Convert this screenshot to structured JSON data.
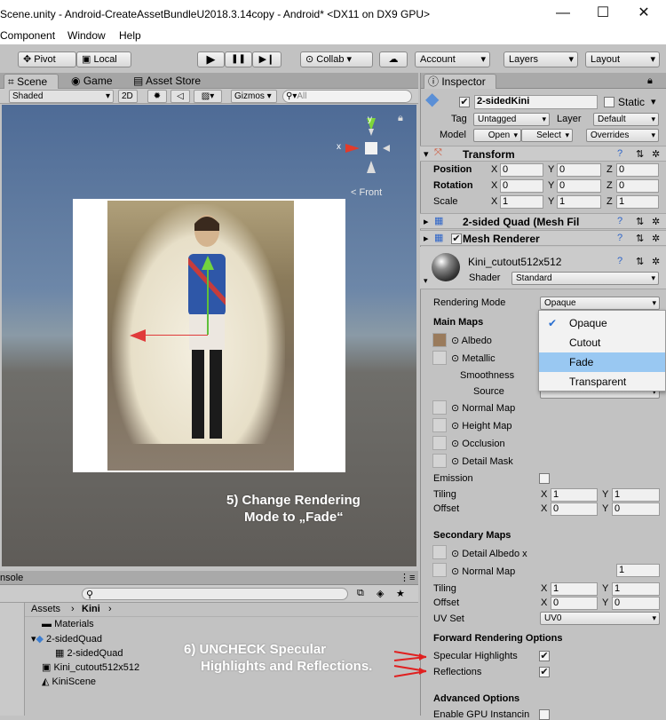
{
  "titlebar": {
    "title": "Scene.unity - Android-CreateAssetBundleU2018.3.14copy - Android* <DX11 on DX9 GPU>",
    "minimize": "—",
    "maximize": "☐",
    "close": "✕"
  },
  "menu": {
    "items": [
      "Component",
      "Window",
      "Help"
    ]
  },
  "toolbar": {
    "pivot": "Pivot",
    "local": "Local",
    "play": "▶",
    "pause": "❚❚",
    "step": "▶❙",
    "collab": "Collab",
    "account": "Account",
    "layers": "Layers",
    "layout": "Layout"
  },
  "scene_tabs": {
    "scene": "Scene",
    "game": "Game",
    "asset_store": "Asset Store"
  },
  "scene_bar": {
    "shading": "Shaded",
    "mode_2d": "2D",
    "gizmos": "Gizmos",
    "search_placeholder": "All"
  },
  "gizmo": {
    "y": "y",
    "x": "x",
    "front": "Front"
  },
  "captions": {
    "step5_line1": "5) Change Rendering",
    "step5_line2": "Mode to „Fade“",
    "step6_line1": "6) UNCHECK Specular",
    "step6_line2": "Highlights and Reflections."
  },
  "console": {
    "tab": "nsole",
    "breadcrumb_root": "Assets",
    "breadcrumb_child": "Kini",
    "assets": [
      "Materials",
      "2-sidedQuad",
      "2-sidedQuad",
      "Kini_cutout512x512",
      "KiniScene"
    ]
  },
  "inspector": {
    "tab": "Inspector",
    "object_name": "2-sidedKini",
    "static": "Static",
    "tag_label": "Tag",
    "tag_value": "Untagged",
    "layer_label": "Layer",
    "layer_value": "Default",
    "model_label": "Model",
    "open": "Open",
    "select": "Select",
    "overrides": "Overrides",
    "transform": {
      "title": "Transform",
      "position": {
        "label": "Position",
        "x": "0",
        "y": "0",
        "z": "0"
      },
      "rotation": {
        "label": "Rotation",
        "x": "0",
        "y": "0",
        "z": "0"
      },
      "scale": {
        "label": "Scale",
        "x": "1",
        "y": "1",
        "z": "1"
      }
    },
    "mesh_filter": "2-sided Quad (Mesh Fil",
    "mesh_renderer": "Mesh Renderer",
    "material": {
      "name": "Kini_cutout512x512",
      "shader_label": "Shader",
      "shader_value": "Standard"
    },
    "rendering_mode": {
      "label": "Rendering Mode",
      "value": "Opaque"
    },
    "main_maps": {
      "title": "Main Maps",
      "albedo": "Albedo",
      "metallic": "Metallic",
      "smoothness": "Smoothness",
      "source": "Source",
      "normal": "Normal Map",
      "height": "Height Map",
      "occlusion": "Occlusion",
      "detail_mask": "Detail Mask",
      "emission": "Emission",
      "tiling": "Tiling",
      "offset": "Offset",
      "tiling_x": "1",
      "tiling_y": "1",
      "offset_x": "0",
      "offset_y": "0"
    },
    "secondary_maps": {
      "title": "Secondary Maps",
      "detail_albedo": "Detail Albedo x",
      "normal": "Normal Map",
      "normal_value": "1",
      "tiling": "Tiling",
      "offset": "Offset",
      "tiling_x": "1",
      "tiling_y": "1",
      "offset_x": "0",
      "offset_y": "0",
      "uv_set_label": "UV Set",
      "uv_set_value": "UV0"
    },
    "forward": {
      "title": "Forward Rendering Options",
      "specular": "Specular Highlights",
      "reflections": "Reflections"
    },
    "advanced": {
      "title": "Advanced Options",
      "gpu": "Enable GPU Instancin"
    },
    "axis": {
      "x": "X",
      "y": "Y",
      "z": "Z"
    }
  },
  "popup": {
    "options": [
      "Opaque",
      "Cutout",
      "Fade",
      "Transparent"
    ],
    "checked": "Opaque",
    "highlighted": "Fade"
  },
  "colors": {
    "accent_selected": "#99c8f2",
    "annotation_arrow": "#e02020",
    "scene_sky": "#4e6b96"
  }
}
